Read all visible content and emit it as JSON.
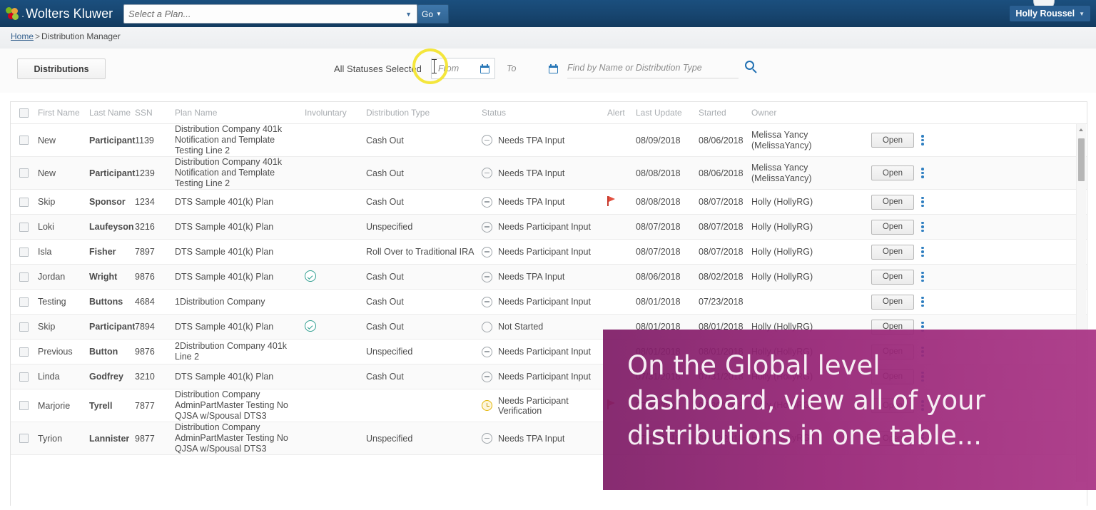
{
  "topbar": {
    "brand": "Wolters Kluwer",
    "brand_separator": ".",
    "plan_placeholder": "Select a Plan...",
    "go_label": "Go",
    "user": "Holly Roussel"
  },
  "breadcrumb": {
    "home": "Home",
    "separator": ">",
    "current": "Distribution Manager"
  },
  "filters": {
    "tab_label": "Distributions",
    "status_label": "All Statuses Selected",
    "date_from_placeholder": "From",
    "date_to_placeholder": "To",
    "search_placeholder": "Find by Name or Distribution Type"
  },
  "table": {
    "columns": [
      "First Name",
      "Last Name",
      "SSN",
      "Plan Name",
      "Involuntary",
      "Distribution Type",
      "Status",
      "Alert",
      "Last Update",
      "Started",
      "Owner"
    ],
    "open_label": "Open",
    "rows": [
      {
        "first": "New",
        "last": "Participant...",
        "ssn": "1139",
        "plan": "Distribution Company 401k Notification and Template Testing Line 2",
        "involuntary": "",
        "dtype": "Cash Out",
        "status": "Needs TPA Input",
        "status_icon": "minus",
        "alert": "",
        "updated": "08/09/2018",
        "started": "08/06/2018",
        "owner": "Melissa Yancy (MelissaYancy)"
      },
      {
        "first": "New",
        "last": "Participant",
        "ssn": "1239",
        "plan": "Distribution Company 401k Notification and Template Testing Line 2",
        "involuntary": "",
        "dtype": "Cash Out",
        "status": "Needs TPA Input",
        "status_icon": "minus",
        "alert": "",
        "updated": "08/08/2018",
        "started": "08/06/2018",
        "owner": "Melissa Yancy (MelissaYancy)"
      },
      {
        "first": "Skip",
        "last": "Sponsor",
        "ssn": "1234",
        "plan": "DTS Sample 401(k) Plan",
        "involuntary": "",
        "dtype": "Cash Out",
        "status": "Needs TPA Input",
        "status_icon": "minus",
        "alert": "flag",
        "updated": "08/08/2018",
        "started": "08/07/2018",
        "owner": "Holly (HollyRG)"
      },
      {
        "first": "Loki",
        "last": "Laufeyson",
        "ssn": "3216",
        "plan": "DTS Sample 401(k) Plan",
        "involuntary": "",
        "dtype": "Unspecified",
        "status": "Needs Participant Input",
        "status_icon": "minus",
        "alert": "",
        "updated": "08/07/2018",
        "started": "08/07/2018",
        "owner": "Holly (HollyRG)"
      },
      {
        "first": "Isla",
        "last": "Fisher",
        "ssn": "7897",
        "plan": "DTS Sample 401(k) Plan",
        "involuntary": "",
        "dtype": "Roll Over to Traditional IRA",
        "status": "Needs Participant Input",
        "status_icon": "minus",
        "alert": "",
        "updated": "08/07/2018",
        "started": "08/07/2018",
        "owner": "Holly (HollyRG)"
      },
      {
        "first": "Jordan",
        "last": "Wright",
        "ssn": "9876",
        "plan": "DTS Sample 401(k) Plan",
        "involuntary": "check",
        "dtype": "Cash Out",
        "status": "Needs TPA Input",
        "status_icon": "minus",
        "alert": "",
        "updated": "08/06/2018",
        "started": "08/02/2018",
        "owner": "Holly (HollyRG)"
      },
      {
        "first": "Testing",
        "last": "Buttons",
        "ssn": "4684",
        "plan": "1Distribution Company",
        "involuntary": "",
        "dtype": "Cash Out",
        "status": "Needs Participant Input",
        "status_icon": "minus",
        "alert": "",
        "updated": "08/01/2018",
        "started": "07/23/2018",
        "owner": ""
      },
      {
        "first": "Skip",
        "last": "Participant",
        "ssn": "7894",
        "plan": "DTS Sample 401(k) Plan",
        "involuntary": "check",
        "dtype": "Cash Out",
        "status": "Not Started",
        "status_icon": "empty",
        "alert": "",
        "updated": "08/01/2018",
        "started": "08/01/2018",
        "owner": "Holly (HollyRG)"
      },
      {
        "first": "Previous",
        "last": "Button",
        "ssn": "9876",
        "plan": "2Distribution Company 401k Line 2",
        "involuntary": "",
        "dtype": "Unspecified",
        "status": "Needs Participant Input",
        "status_icon": "minus",
        "alert": "",
        "updated": "08/01/2018",
        "started": "08/01/2018",
        "owner": "Holly (HollyRG)"
      },
      {
        "first": "Linda",
        "last": "Godfrey",
        "ssn": "3210",
        "plan": "DTS Sample 401(k) Plan",
        "involuntary": "",
        "dtype": "Cash Out",
        "status": "Needs Participant Input",
        "status_icon": "minus",
        "alert": "",
        "updated": "07/31/2018",
        "started": "07/31/2018",
        "owner": "Holly (HollyRG)"
      },
      {
        "first": "Marjorie",
        "last": "Tyrell",
        "ssn": "7877",
        "plan": "Distribution Company AdminPartMaster Testing No QJSA w/Spousal DTS3",
        "involuntary": "",
        "dtype": "",
        "status": "Needs Participant Verification",
        "status_icon": "clock",
        "alert": "flag",
        "updated": "07/30/2018",
        "started": "07/30/2018",
        "owner": "Holly (HollyRG)"
      },
      {
        "first": "Tyrion",
        "last": "Lannister",
        "ssn": "9877",
        "plan": "Distribution Company AdminPartMaster Testing No QJSA w/Spousal DTS3",
        "involuntary": "",
        "dtype": "Unspecified",
        "status": "Needs TPA Input",
        "status_icon": "minus",
        "alert": "",
        "updated": "07/30/2018",
        "started": "06/12/2018",
        "owner": "Holly (HollyRG)"
      }
    ]
  },
  "caption": {
    "line1": "On the Global level",
    "line2": "dashboard, view all of your",
    "line3": "distributions in one table..."
  },
  "colors": {
    "topbar": "#17456f",
    "caption_purple": "#962375",
    "link": "#36618e",
    "accent_blue": "#2f7fc1",
    "highlight_yellow": "#f4e63c",
    "involuntary_green": "#2e9e8f",
    "alert_red": "#e2503f",
    "clock_yellow": "#e3b505"
  }
}
